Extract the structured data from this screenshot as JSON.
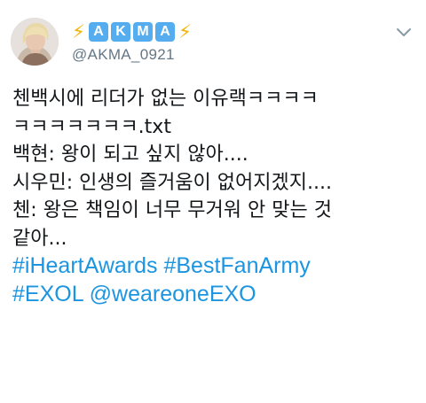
{
  "tweet": {
    "display_name": {
      "left_icon": "lightning-bolt-icon",
      "right_icon": "lightning-bolt-icon",
      "boxed_letters": [
        "A",
        "K",
        "M",
        "A"
      ],
      "bolt_color": "#f5b301",
      "box_color": "#55acee"
    },
    "handle": "@AKMA_0921",
    "menu_icon": "chevron-down-icon",
    "lines": [
      "첸백시에 리더가 없는 이유랙ㅋㅋㅋㅋ",
      "ㅋㅋㅋㅋㅋㅋㅋ.txt",
      "백현: 왕이 되고 싶지 않아....",
      "시우민: 인생의 즐거움이 없어지겠지....",
      "첸: 왕은 책임이 너무 무거워 안 맞는 것",
      "같아..."
    ],
    "hashtag_lines": [
      [
        "#iHeartAwards",
        "#BestFanArmy"
      ],
      [
        "#EXOL",
        "@weareoneEXO"
      ]
    ],
    "link_color": "#1b95e0"
  }
}
